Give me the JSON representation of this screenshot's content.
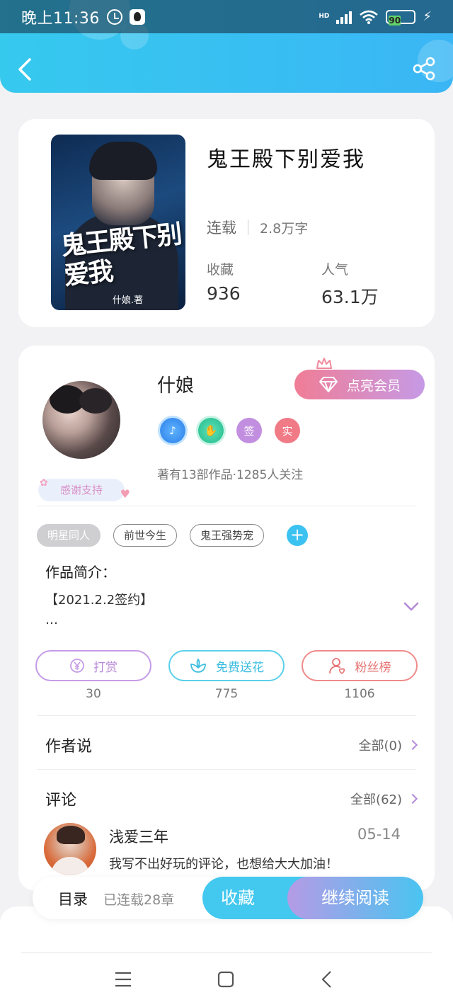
{
  "status_bar": {
    "time": "晚上11:36",
    "battery": "90",
    "network": "HD"
  },
  "header": {
    "back_icon": "chevron-left-icon",
    "share_icon": "share-icon"
  },
  "book": {
    "title": "鬼王殿下别爱我",
    "cover_title": "鬼王殿下别爱我",
    "cover_author": "什娘.著",
    "status": "连载",
    "word_count": "2.8万字",
    "favorites_label": "收藏",
    "favorites_value": "936",
    "popularity_label": "人气",
    "popularity_value": "63.1万"
  },
  "author": {
    "name": "什娘",
    "vip_button": "点亮会员",
    "thanks_tag": "感谢支持",
    "badges": [
      {
        "icon": "music-note-icon",
        "label": ""
      },
      {
        "icon": "handshake-icon",
        "label": ""
      },
      {
        "icon": "sign-badge-icon",
        "label": "签"
      },
      {
        "icon": "real-name-badge-icon",
        "label": "实"
      }
    ],
    "meta": "著有13部作品·1285人关注"
  },
  "tags": [
    "明星同人",
    "前世今生",
    "鬼王强势宠"
  ],
  "intro": {
    "title": "作品简介：",
    "line1": "【2021.2.2签约】",
    "line2": "…"
  },
  "actions": [
    {
      "label": "打赏",
      "count": "30",
      "icon": "yen-icon",
      "color": "#c59be6"
    },
    {
      "label": "免费送花",
      "count": "775",
      "icon": "flower-icon",
      "color": "#5ad0ea"
    },
    {
      "label": "粉丝榜",
      "count": "1106",
      "icon": "fan-rank-icon",
      "color": "#f08a8a"
    }
  ],
  "author_says": {
    "title": "作者说",
    "link": "全部(0)"
  },
  "comments": {
    "title": "评论",
    "link": "全部(62)",
    "items": [
      {
        "user": "浅爱三年",
        "date": "05-14",
        "text": "我写不出好玩的评论，也想给大大加油！"
      }
    ]
  },
  "bottom_bar": {
    "toc_label": "目录",
    "toc_sub": "已连载28章",
    "favorite_button": "收藏",
    "read_button": "继续阅读"
  },
  "colors": {
    "header": "#36c9ee",
    "accent_purple": "#b58ad6",
    "accent_blue": "#43c8ef",
    "vip_pink": "#f07d96"
  }
}
